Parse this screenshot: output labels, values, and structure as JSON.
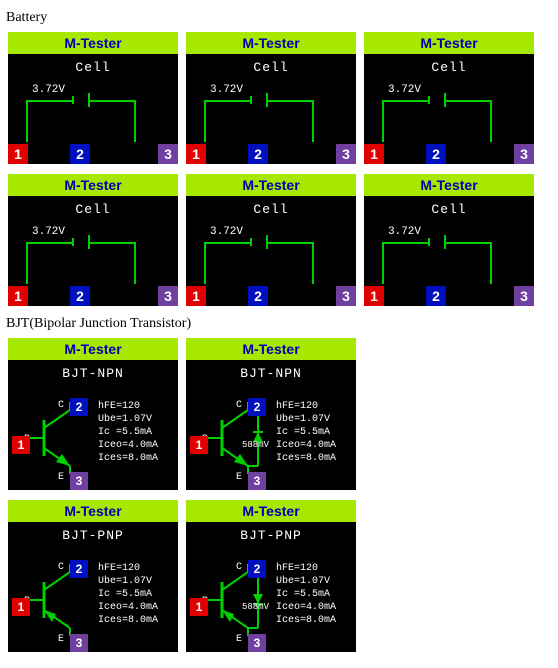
{
  "section_battery_label": "Battery",
  "section_bjt_label": "BJT(Bipolar Junction Transistor)",
  "tester_title": "M-Tester",
  "cell": {
    "type_label": "Cell",
    "voltage": "3.72V",
    "pins": {
      "p1": "1",
      "p2": "2",
      "p3": "3"
    }
  },
  "bjt_npn": {
    "type_label": "BJT-NPN",
    "pins": {
      "p1": "1",
      "p2": "2",
      "p3": "3"
    },
    "letters": {
      "c": "C",
      "b": "B",
      "e": "E"
    },
    "diode_mv": "588mV",
    "params_text": "hFE=120\nUbe=1.07V\nIc =5.5mA\nIceo=4.0mA\nIces=8.0mA"
  },
  "bjt_pnp": {
    "type_label": "BJT-PNP",
    "pins": {
      "p1": "1",
      "p2": "2",
      "p3": "3"
    },
    "letters": {
      "c": "C",
      "b": "B",
      "e": "E"
    },
    "diode_mv": "588mV",
    "params_text": "hFE=120\nUbe=1.07V\nIc =5.5mA\nIceo=4.0mA\nIces=8.0mA"
  }
}
